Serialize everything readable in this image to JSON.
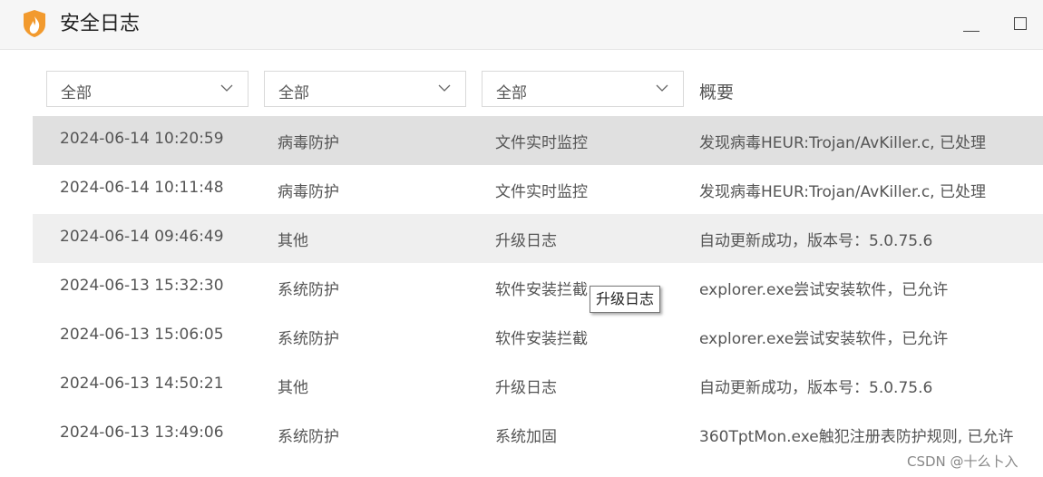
{
  "window": {
    "title": "安全日志",
    "accent_color": "#f29a2e",
    "icons": {
      "logo": "flame-shield-icon",
      "minimize": "minimize-icon",
      "maximize": "maximize-icon"
    }
  },
  "filters": {
    "category": "全部",
    "source": "全部",
    "type": "全部",
    "summary_header": "概要"
  },
  "logs": [
    {
      "time": "2024-06-14 10:20:59",
      "category": "病毒防护",
      "source": "文件实时监控",
      "summary": "发现病毒HEUR:Trojan/AvKiller.c, 已处理"
    },
    {
      "time": "2024-06-14 10:11:48",
      "category": "病毒防护",
      "source": "文件实时监控",
      "summary": "发现病毒HEUR:Trojan/AvKiller.c, 已处理"
    },
    {
      "time": "2024-06-14 09:46:49",
      "category": "其他",
      "source": "升级日志",
      "summary": "自动更新成功，版本号：5.0.75.6"
    },
    {
      "time": "2024-06-13 15:32:30",
      "category": "系统防护",
      "source": "软件安装拦截",
      "summary": "explorer.exe尝试安装软件，已允许"
    },
    {
      "time": "2024-06-13 15:06:05",
      "category": "系统防护",
      "source": "软件安装拦截",
      "summary": "explorer.exe尝试安装软件，已允许"
    },
    {
      "time": "2024-06-13 14:50:21",
      "category": "其他",
      "source": "升级日志",
      "summary": "自动更新成功，版本号：5.0.75.6"
    },
    {
      "time": "2024-06-13 13:49:06",
      "category": "系统防护",
      "source": "系统加固",
      "summary": "360TptMon.exe触犯注册表防护规则, 已允许"
    }
  ],
  "tooltip": "升级日志",
  "watermark": "CSDN @十么卜入"
}
